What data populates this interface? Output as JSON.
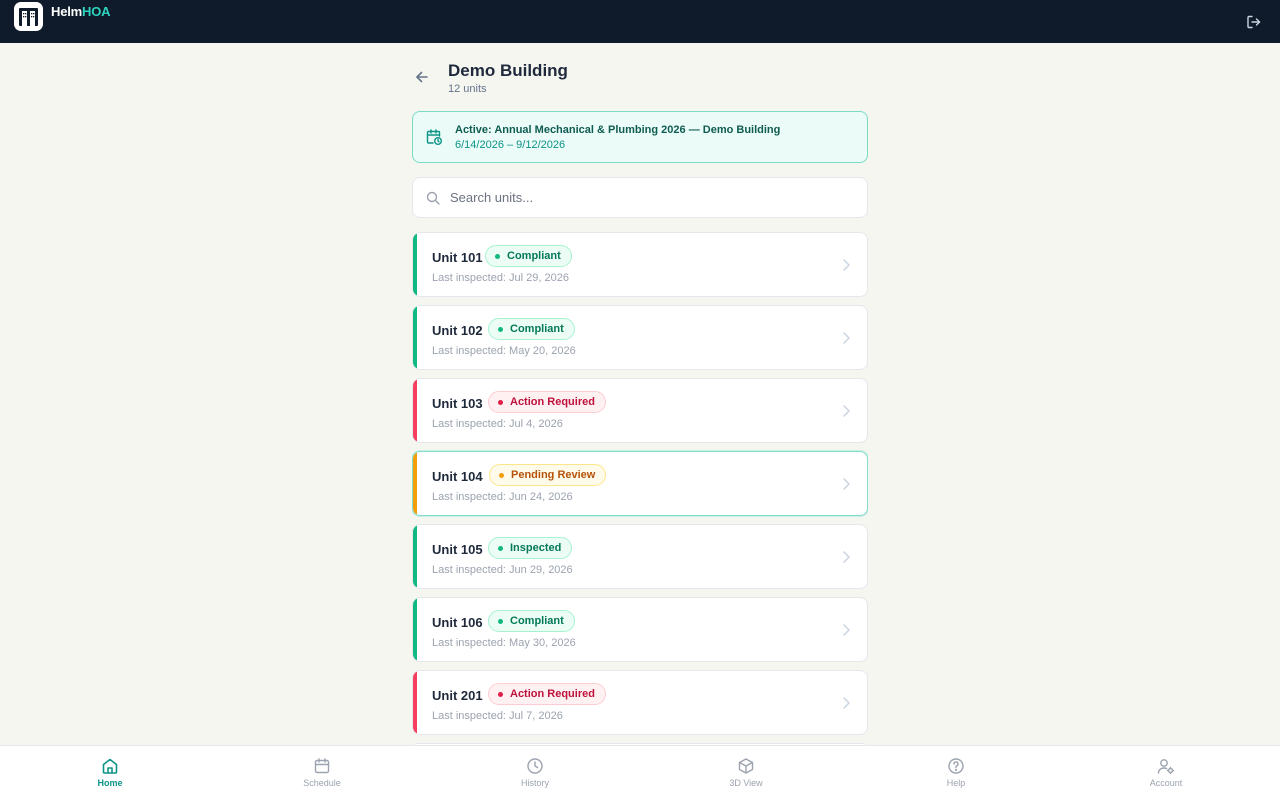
{
  "app": {
    "brand_prefix": "Helm",
    "brand_accent": "HOA",
    "accent_color": "#0d9488"
  },
  "page": {
    "title": "Demo Building",
    "subtitle": "12 units"
  },
  "banner": {
    "title": "Active: Annual Mechanical & Plumbing 2026 — Demo Building",
    "dates": "6/14/2026 – 9/12/2026"
  },
  "search": {
    "placeholder": "Search units..."
  },
  "units": [
    {
      "name": "Unit 101",
      "status": "Compliant",
      "last": "Last inspected: Jul 29, 2026",
      "tone": "green"
    },
    {
      "name": "Unit 102",
      "status": "Compliant",
      "last": "Last inspected: May 20, 2026",
      "tone": "green"
    },
    {
      "name": "Unit 103",
      "status": "Action Required",
      "last": "Last inspected: Jul 4, 2026",
      "tone": "red"
    },
    {
      "name": "Unit 104",
      "status": "Pending Review",
      "last": "Last inspected: Jun 24, 2026",
      "tone": "amber"
    },
    {
      "name": "Unit 105",
      "status": "Inspected",
      "last": "Last inspected: Jun 29, 2026",
      "tone": "green"
    },
    {
      "name": "Unit 106",
      "status": "Compliant",
      "last": "Last inspected: May 30, 2026",
      "tone": "green"
    },
    {
      "name": "Unit 201",
      "status": "Action Required",
      "last": "Last inspected: Jul 7, 2026",
      "tone": "red"
    }
  ],
  "status_colors": {
    "green": {
      "bar": "#10b981",
      "bg": "#ecfdf5",
      "border": "#a7f3d0",
      "text": "#047857",
      "dot": "#10b981"
    },
    "red": {
      "bar": "#f43f5e",
      "bg": "#fff1f2",
      "border": "#fecdd3",
      "text": "#be123c",
      "dot": "#e11d48"
    },
    "amber": {
      "bar": "#f59e0b",
      "bg": "#fffbeb",
      "border": "#fde68a",
      "text": "#b45309",
      "dot": "#f59e0b"
    }
  },
  "nav": [
    {
      "label": "Home",
      "icon": "home-icon",
      "active": true
    },
    {
      "label": "Schedule",
      "icon": "calendar-icon",
      "active": false
    },
    {
      "label": "History",
      "icon": "clock-icon",
      "active": false
    },
    {
      "label": "3D View",
      "icon": "cube-icon",
      "active": false
    },
    {
      "label": "Help",
      "icon": "help-circle-icon",
      "active": false
    },
    {
      "label": "Account",
      "icon": "user-gear-icon",
      "active": false
    }
  ]
}
